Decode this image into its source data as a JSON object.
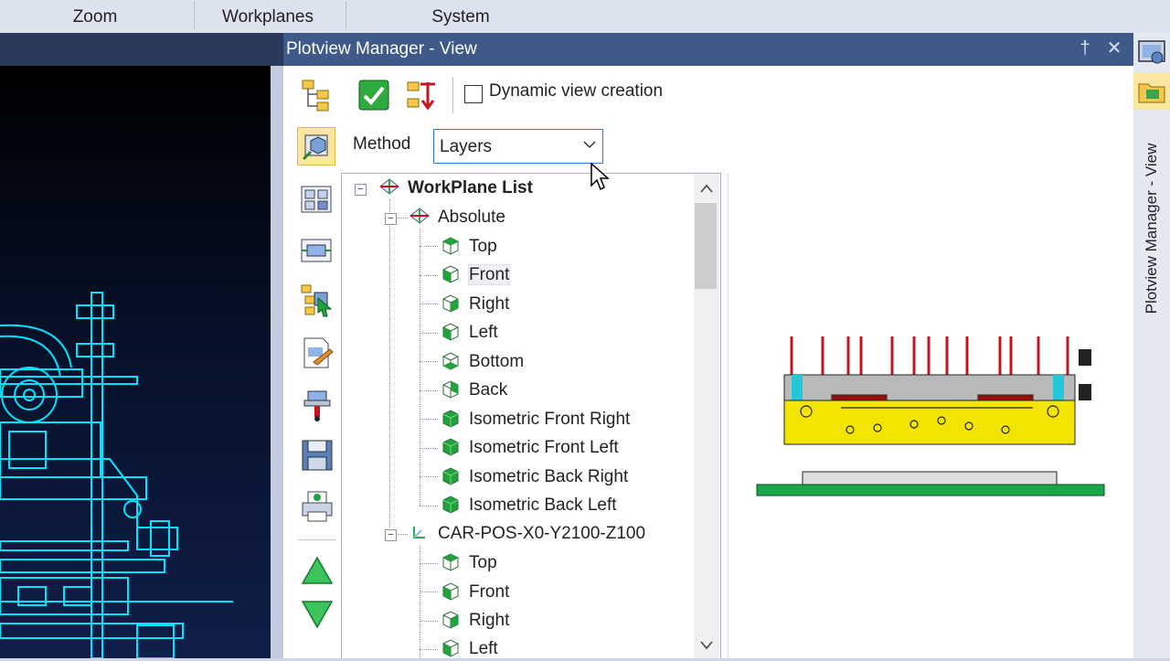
{
  "menubar": {
    "items": [
      "Zoom",
      "Workplanes",
      "System"
    ]
  },
  "window": {
    "title": "Plotview Manager - View",
    "side_tab_label": "Plotview Manager - View",
    "pin_glyph": "†",
    "close_glyph": "✕"
  },
  "toolbar": {
    "dynamic_view_label": "Dynamic view creation",
    "dynamic_view_checked": false
  },
  "method": {
    "label": "Method",
    "value": "Layers"
  },
  "tree": {
    "root_label": "WorkPlane List",
    "groups": [
      {
        "label": "Absolute",
        "children": [
          "Top",
          "Front",
          "Right",
          "Left",
          "Bottom",
          "Back",
          "Isometric Front Right",
          "Isometric Front Left",
          "Isometric Back Right",
          "Isometric Back Left"
        ],
        "selected": "Front"
      },
      {
        "label": "CAR-POS-X0-Y2100-Z100",
        "children": [
          "Top",
          "Front",
          "Right",
          "Left"
        ]
      }
    ]
  },
  "icons": {
    "left_toolbar": [
      "view-method-icon",
      "multi-view-icon",
      "view-frame-icon",
      "tree-select-icon",
      "edit-view-icon",
      "probe-icon",
      "save-icon",
      "print-icon",
      "move-up-icon",
      "move-down-icon"
    ],
    "top_toolbar": [
      "tree-view-icon",
      "apply-check-icon",
      "refresh-tree-icon"
    ]
  },
  "colors": {
    "title_bar": "#3f5a88",
    "accent": "#2f7ad6",
    "cad_wire": "#00e5ff",
    "part_yellow": "#f2e600",
    "plate_green": "#18a84a",
    "pins_red": "#c8141e"
  }
}
